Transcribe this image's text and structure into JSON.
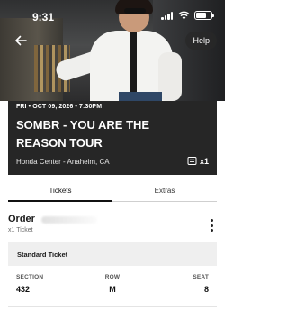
{
  "status_bar": {
    "time": "9:31"
  },
  "header": {
    "help_label": "Help"
  },
  "event": {
    "date_line": "FRI • OCT 09, 2026 • 7:30PM",
    "title": "SOMBR - YOU ARE THE REASON TOUR",
    "venue": "Honda Center - Anaheim, CA",
    "ticket_count": "x1"
  },
  "tabs": [
    {
      "label": "Tickets",
      "active": true
    },
    {
      "label": "Extras",
      "active": false
    }
  ],
  "order": {
    "title": "Order",
    "subtitle": "x1 Ticket"
  },
  "ticket": {
    "type": "Standard Ticket",
    "section_label": "SECTION",
    "section_value": "432",
    "row_label": "ROW",
    "row_value": "M",
    "seat_label": "SEAT",
    "seat_value": "8"
  },
  "colors": {
    "event_card_bg": "#262626",
    "ticket_type_bg": "#efefef",
    "active_tab_underline": "#111111"
  },
  "icons": [
    "back-arrow-icon",
    "cellular-icon",
    "wifi-icon",
    "battery-icon",
    "ticket-icon",
    "more-vertical-icon"
  ]
}
